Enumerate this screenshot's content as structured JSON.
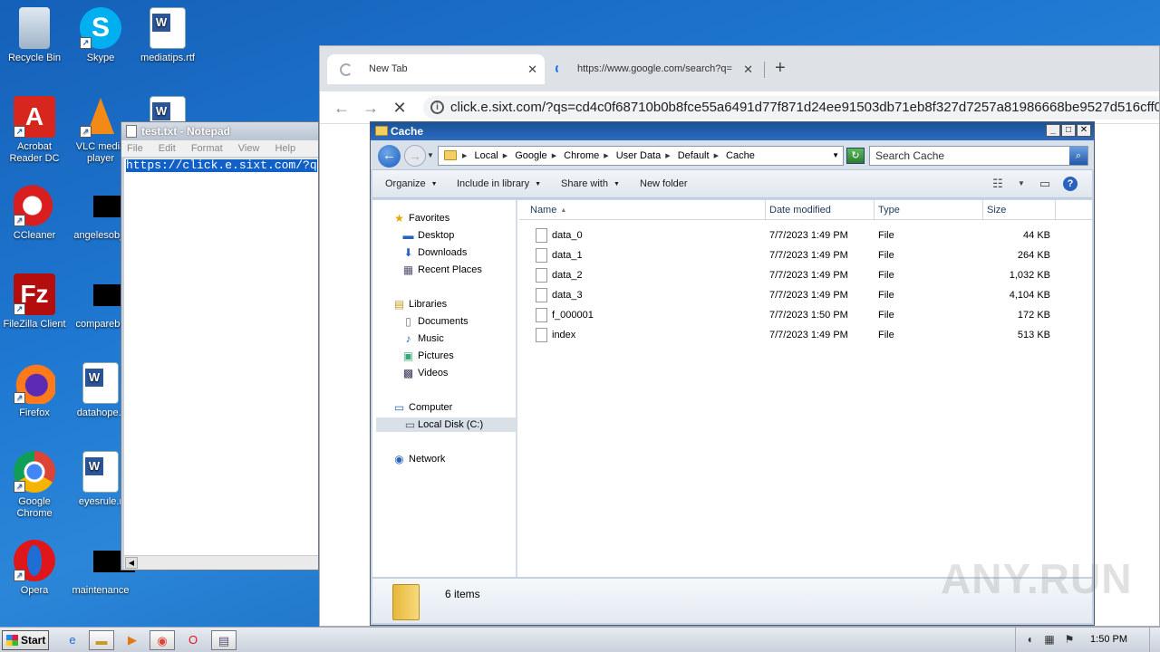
{
  "desktop": {
    "icons": [
      {
        "label": "Recycle Bin",
        "icon": "recycle-bin-icon"
      },
      {
        "label": "Skype",
        "icon": "skype-icon"
      },
      {
        "label": "mediatips.rtf",
        "icon": "word-document-icon"
      },
      {
        "label": "Acrobat Reader DC",
        "icon": "acrobat-icon"
      },
      {
        "label": "VLC media player",
        "icon": "vlc-icon"
      },
      {
        "label": "CCleaner",
        "icon": "ccleaner-icon"
      },
      {
        "label": "angelesobje",
        "icon": "redacted-file-icon"
      },
      {
        "label": "FileZilla Client",
        "icon": "filezilla-icon"
      },
      {
        "label": "comparebo",
        "icon": "redacted-file-icon"
      },
      {
        "label": "Firefox",
        "icon": "firefox-icon"
      },
      {
        "label": "datahope.r",
        "icon": "word-document-icon"
      },
      {
        "label": "Google Chrome",
        "icon": "chrome-icon"
      },
      {
        "label": "eyesrule.r",
        "icon": "word-document-icon"
      },
      {
        "label": "Opera",
        "icon": "opera-icon"
      },
      {
        "label": "maintenance",
        "icon": "redacted-file-icon"
      }
    ]
  },
  "chrome": {
    "tabs": [
      {
        "label": "New Tab",
        "close": "✕"
      },
      {
        "label": "https://www.google.com/search?q=",
        "close": "✕"
      }
    ],
    "new_tab": "+",
    "url": "click.e.sixt.com/?qs=cd4c0f68710b0b8fce55a6491d77f871d24ee91503db71eb8f327d7257a81986668be9527d516cff0ccd2..."
  },
  "notepad": {
    "title": "test.txt - Notepad",
    "menu": [
      "File",
      "Edit",
      "Format",
      "View",
      "Help"
    ],
    "content": "https://click.e.sixt.com/?q"
  },
  "explorer": {
    "title": "Cache",
    "breadcrumbs": [
      "Local",
      "Google",
      "Chrome",
      "User Data",
      "Default",
      "Cache"
    ],
    "search_placeholder": "Search Cache",
    "toolbar": {
      "organize": "Organize",
      "include": "Include in library",
      "share": "Share with",
      "new_folder": "New folder"
    },
    "nav": {
      "favorites": "Favorites",
      "desktop": "Desktop",
      "downloads": "Downloads",
      "recent": "Recent Places",
      "libraries": "Libraries",
      "documents": "Documents",
      "music": "Music",
      "pictures": "Pictures",
      "videos": "Videos",
      "computer": "Computer",
      "local_disk": "Local Disk (C:)",
      "network": "Network"
    },
    "columns": [
      "Name",
      "Date modified",
      "Type",
      "Size"
    ],
    "files": [
      {
        "name": "data_0",
        "date": "7/7/2023 1:49 PM",
        "type": "File",
        "size": "44 KB"
      },
      {
        "name": "data_1",
        "date": "7/7/2023 1:49 PM",
        "type": "File",
        "size": "264 KB"
      },
      {
        "name": "data_2",
        "date": "7/7/2023 1:49 PM",
        "type": "File",
        "size": "1,032 KB"
      },
      {
        "name": "data_3",
        "date": "7/7/2023 1:49 PM",
        "type": "File",
        "size": "4,104 KB"
      },
      {
        "name": "f_000001",
        "date": "7/7/2023 1:50 PM",
        "type": "File",
        "size": "172 KB"
      },
      {
        "name": "index",
        "date": "7/7/2023 1:49 PM",
        "type": "File",
        "size": "513 KB"
      }
    ],
    "item_count": "6 items"
  },
  "watermark": "ANY.RUN",
  "taskbar": {
    "start": "Start",
    "clock": "1:50 PM"
  }
}
